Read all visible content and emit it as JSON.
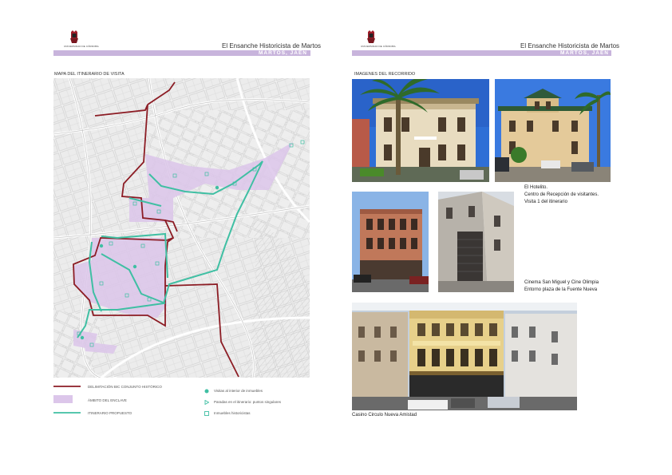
{
  "colors": {
    "accent_bar": "#c8b4dc",
    "bic_line": "#8c1c24",
    "enclave_fill": "#dcc6ea",
    "itinerary_line": "#3fbfa3"
  },
  "left_page": {
    "logo_text": "UNIVERSIDAD DE CÓRDOBA",
    "header_title": "El Ensanche Historicista de Martos",
    "header_subtitle": "MARTOS, JAÉN",
    "section_title": "MAPA DEL ITINERARIO DE VISITA",
    "legend": [
      {
        "icon": "dark-red-line",
        "label": "DELIMITACIÓN BIC CONJUNTO HISTÓRICO"
      },
      {
        "icon": "lilac-area",
        "label": "ÁMBITO DEL ENCLAVE"
      },
      {
        "icon": "teal-line",
        "label": "ITINERARIO PROPUESTO"
      },
      {
        "icon": "teal-dot",
        "label": "Visitas al interior de inmuebles"
      },
      {
        "icon": "teal-triangle",
        "label": "Paradas en el itinerario: puntos singulares"
      },
      {
        "icon": "teal-square",
        "label": "Inmuebles historicistas"
      }
    ]
  },
  "right_page": {
    "logo_text": "UNIVERSIDAD DE CÓRDOBA",
    "header_title": "El Ensanche Historicista de Martos",
    "header_subtitle": "MARTOS, JAÉN",
    "section_title": "IMAGENES DEL RECORRIDO",
    "captions": {
      "hotelito": [
        "El Hotelito.",
        "Centro de Recepción de visitantes.",
        "Visita 1 del itinerario"
      ],
      "cinemas": [
        "Cinema San Miguel y Cine Olimpia",
        "Entorno plaza de la Fuente Nueva"
      ],
      "casino": [
        "Casino Circulo Nueva Amistad"
      ]
    }
  }
}
